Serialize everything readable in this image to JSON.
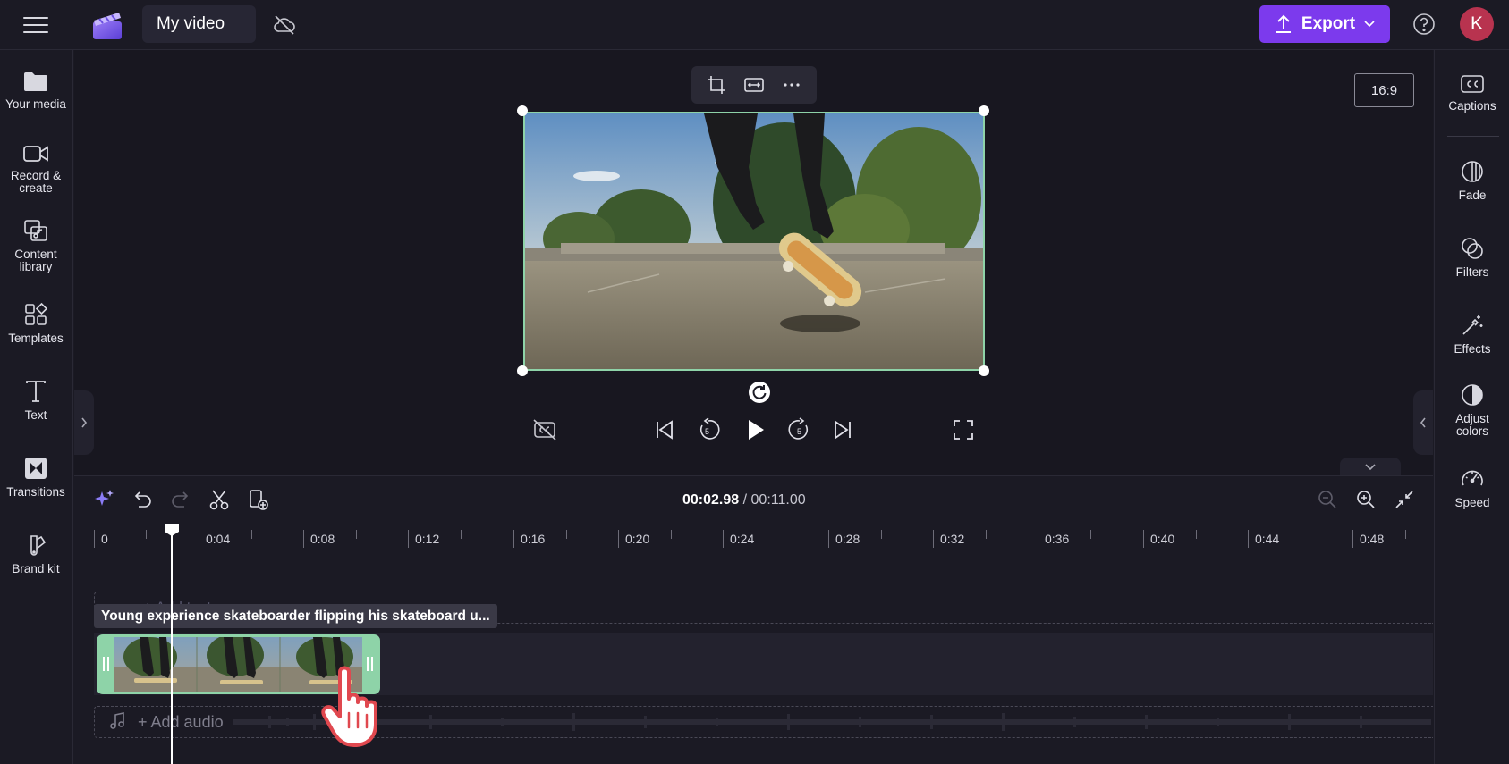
{
  "header": {
    "project_title": "My video",
    "export_label": "Export",
    "avatar_initial": "K"
  },
  "left_sidebar": {
    "items": [
      {
        "label": "Your media"
      },
      {
        "label": "Record &\ncreate"
      },
      {
        "label": "Content\nlibrary"
      },
      {
        "label": "Templates"
      },
      {
        "label": "Text"
      },
      {
        "label": "Transitions"
      },
      {
        "label": "Brand kit"
      }
    ]
  },
  "right_sidebar": {
    "items": [
      {
        "label": "Captions"
      },
      {
        "label": "Fade"
      },
      {
        "label": "Filters"
      },
      {
        "label": "Effects"
      },
      {
        "label": "Adjust\ncolors"
      },
      {
        "label": "Speed"
      }
    ]
  },
  "preview": {
    "aspect_ratio": "16:9"
  },
  "timeline": {
    "current_time": "00:02.98",
    "separator": " / ",
    "total_time": "00:11.00",
    "ruler_labels": [
      "0",
      "0:04",
      "0:08",
      "0:12",
      "0:16",
      "0:20",
      "0:24",
      "0:28",
      "0:32",
      "0:36",
      "0:40",
      "0:44",
      "0:48"
    ],
    "text_track_placeholder": "+ Add text",
    "clip_title": "Young experience skateboarder flipping his skateboard u...",
    "audio_track_placeholder": "+ Add audio"
  },
  "colors": {
    "accent": "#7c3aed",
    "clip_selection": "#8ed3a8",
    "avatar": "#b8334f",
    "background": "#1b1a24"
  }
}
